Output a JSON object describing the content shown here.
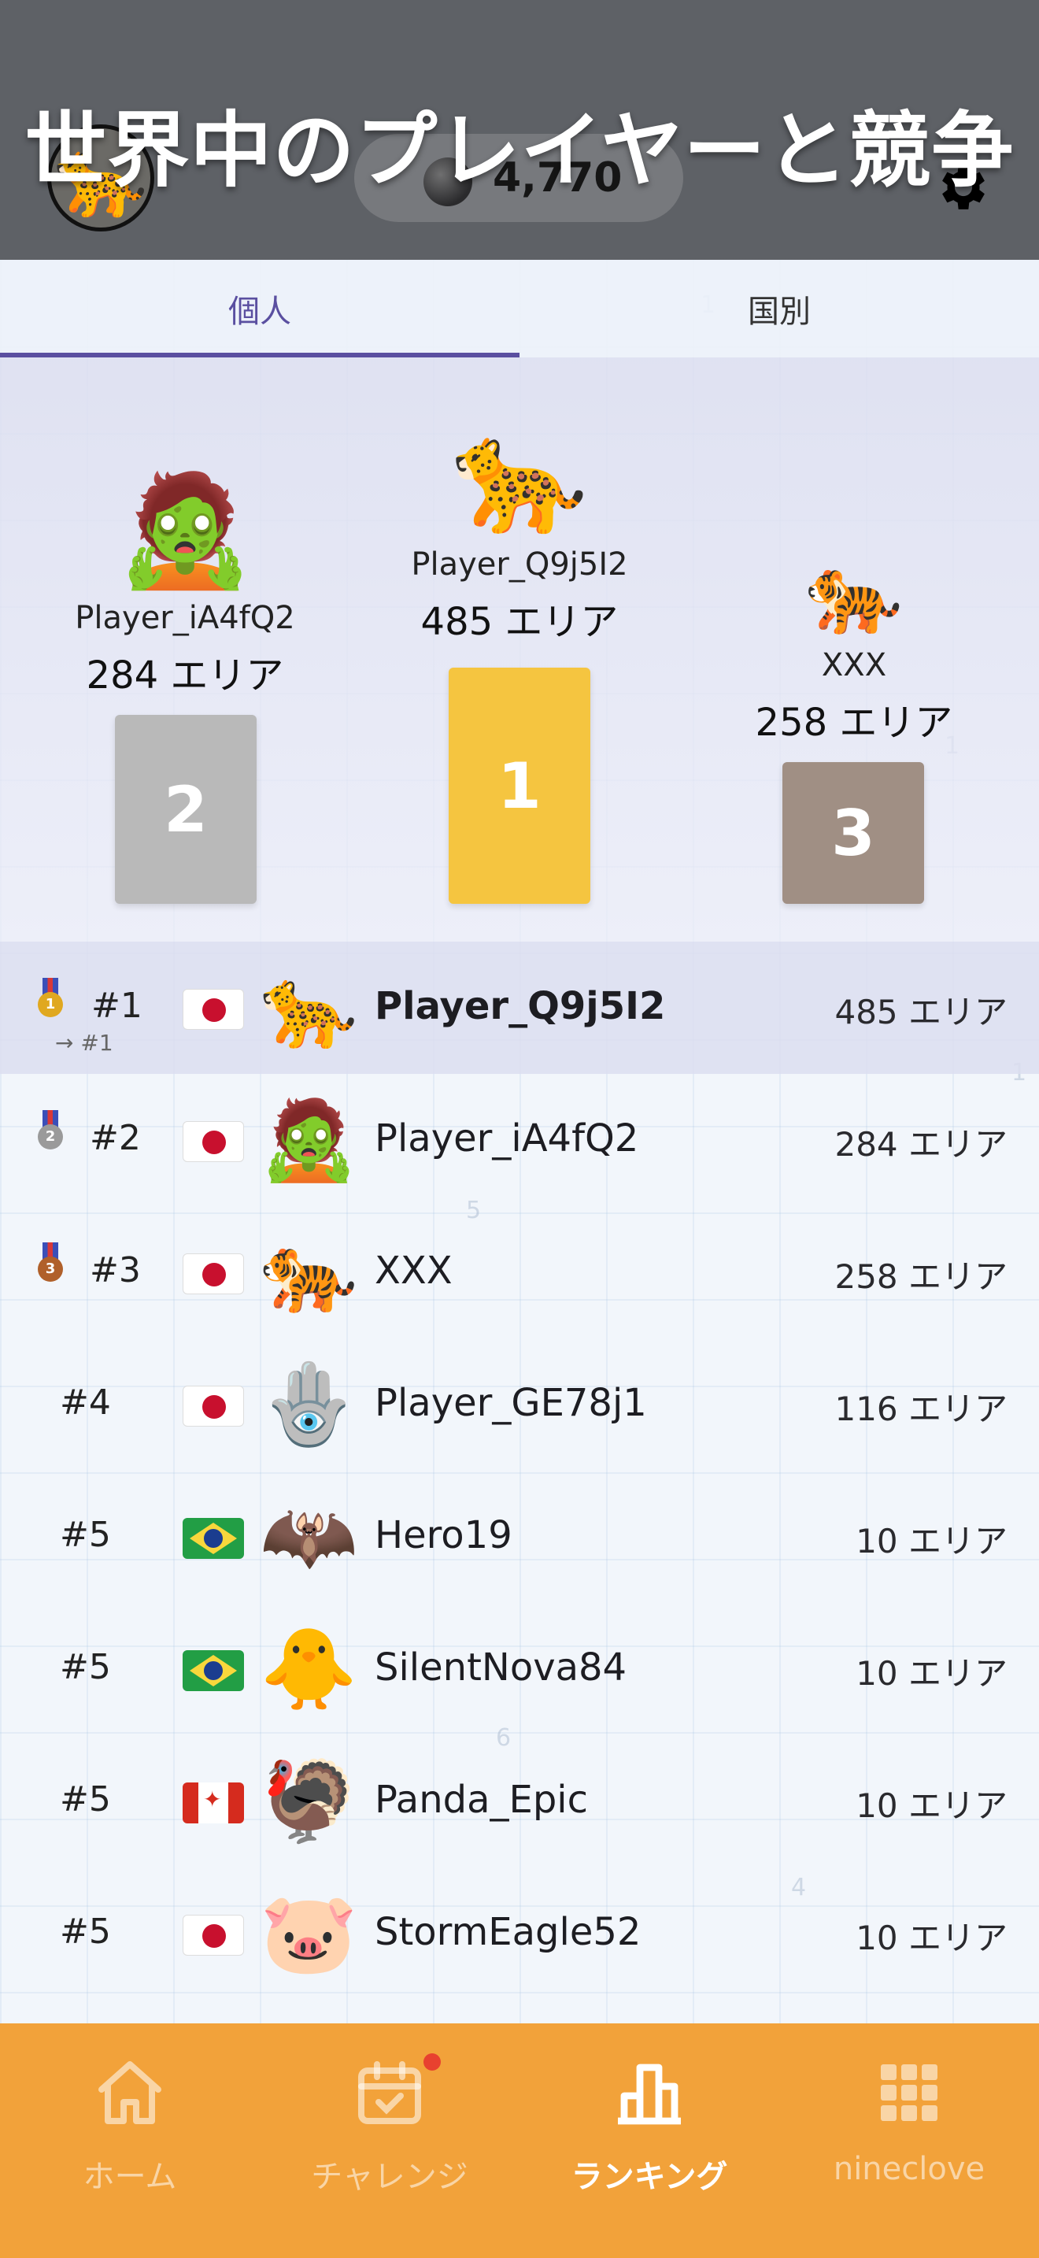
{
  "header": {
    "title": "世界中のプレイヤーと競争",
    "coins": "4,770",
    "avatar_emoji": "🐆",
    "icons": {
      "coin": "moon-coin-icon",
      "settings": "gear-icon"
    }
  },
  "tabs": [
    {
      "label": "個人",
      "active": true
    },
    {
      "label": "国別",
      "active": false
    }
  ],
  "podium": [
    {
      "rank": "2",
      "emoji": "🧟",
      "name": "Player_iA4fQ2",
      "score": "284 エリア",
      "color": "#b9b9b9"
    },
    {
      "rank": "1",
      "emoji": "🐆",
      "name": "Player_Q9j5I2",
      "score": "485 エリア",
      "color": "#f5c540"
    },
    {
      "rank": "3",
      "emoji": "🐅",
      "name": "XXX",
      "score": "258 エリア",
      "color": "#a08f84"
    }
  ],
  "rankings": [
    {
      "rank": "#1",
      "sub": "→ #1",
      "medal": "1",
      "medal_color": "#e0a820",
      "flag": "jp",
      "emoji": "🐆",
      "name": "Player_Q9j5I2",
      "score": "485 エリア",
      "highlight": true
    },
    {
      "rank": "#2",
      "medal": "2",
      "medal_color": "#9a9a9a",
      "flag": "jp",
      "emoji": "🧟",
      "name": "Player_iA4fQ2",
      "score": "284 エリア"
    },
    {
      "rank": "#3",
      "medal": "3",
      "medal_color": "#b0602a",
      "flag": "jp",
      "emoji": "🐅",
      "name": "XXX",
      "score": "258 エリア"
    },
    {
      "rank": "#4",
      "flag": "jp",
      "emoji": "🪬",
      "name": "Player_GE78j1",
      "score": "116 エリア"
    },
    {
      "rank": "#5",
      "flag": "br",
      "emoji": "🦇",
      "name": "Hero19",
      "score": "10 エリア"
    },
    {
      "rank": "#5",
      "flag": "br",
      "emoji": "🐥",
      "name": "SilentNova84",
      "score": "10 エリア"
    },
    {
      "rank": "#5",
      "flag": "ca",
      "emoji": "🦃",
      "name": "Panda_Epic",
      "score": "10 エリア"
    },
    {
      "rank": "#5",
      "flag": "jp",
      "emoji": "🐷",
      "name": "StormEagle52",
      "score": "10 エリア"
    }
  ],
  "nav": [
    {
      "label": "ホーム",
      "icon": "home-icon",
      "active": false
    },
    {
      "label": "チャレンジ",
      "icon": "calendar-check-icon",
      "active": false,
      "badge": true
    },
    {
      "label": "ランキング",
      "icon": "bar-chart-icon",
      "active": true
    },
    {
      "label": "nineclove",
      "icon": "grid-icon",
      "active": false
    }
  ],
  "colors": {
    "header": "#5e6166",
    "nav": "#f2a23a",
    "accent": "#5a4fa0"
  }
}
